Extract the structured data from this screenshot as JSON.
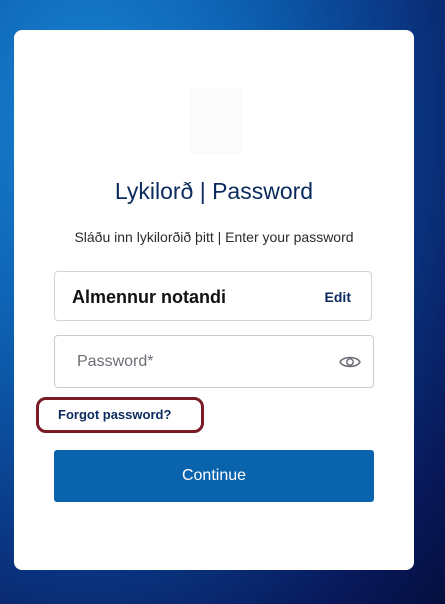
{
  "login": {
    "title": "Lykilorð | Password",
    "subtitle": "Sláðu inn lykilorðið þitt | Enter your password",
    "username": "Almennur notandi",
    "edit_label": "Edit",
    "password_placeholder": "Password*",
    "password_value": "",
    "forgot_label": "Forgot password?",
    "continue_label": "Continue"
  },
  "colors": {
    "primary": "#0a63ad",
    "link": "#0b2a5e",
    "highlight": "#7a1a26"
  },
  "icons": {
    "show_password": "eye-icon",
    "logo": "logo"
  }
}
